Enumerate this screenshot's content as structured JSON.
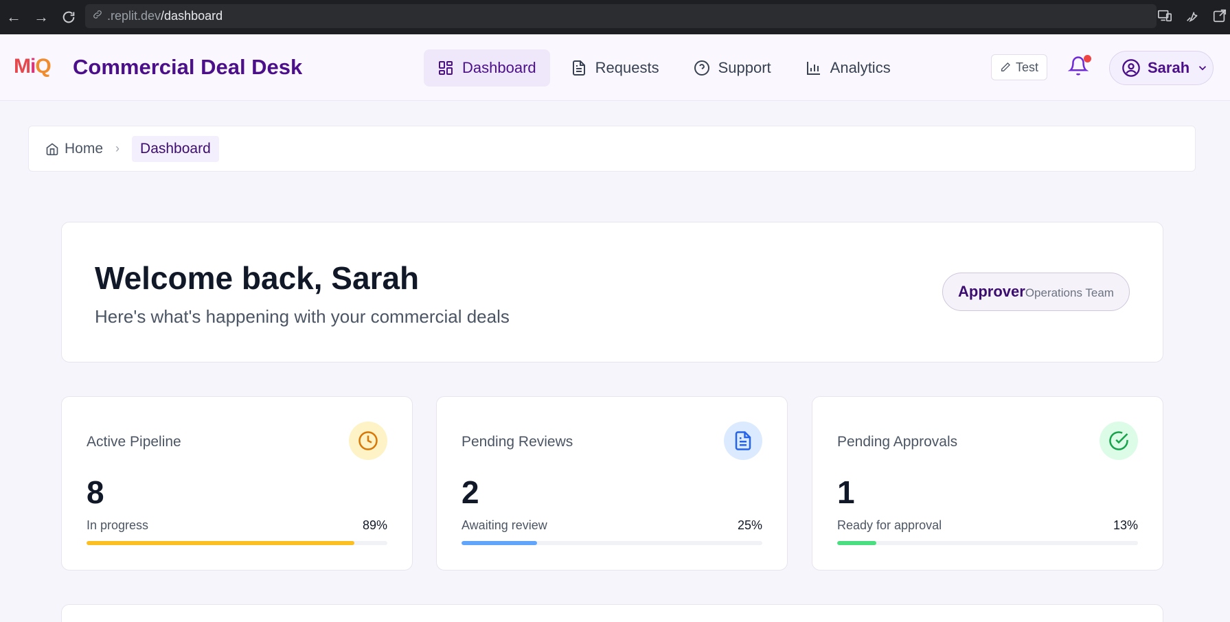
{
  "browser": {
    "url_host": ".replit.dev",
    "url_path": "/dashboard"
  },
  "header": {
    "logo": {
      "m": "M",
      "i": "i",
      "q": "Q"
    },
    "title": "Commercial Deal Desk",
    "nav": [
      {
        "label": "Dashboard",
        "icon": "dashboard-grid-icon",
        "active": true
      },
      {
        "label": "Requests",
        "icon": "document-icon",
        "active": false
      },
      {
        "label": "Support",
        "icon": "help-circle-icon",
        "active": false
      },
      {
        "label": "Analytics",
        "icon": "bar-chart-icon",
        "active": false
      }
    ],
    "test_label": "Test",
    "user_name": "Sarah",
    "has_notification": true
  },
  "breadcrumb": {
    "home": "Home",
    "current": "Dashboard"
  },
  "welcome": {
    "heading": "Welcome back, Sarah",
    "subheading": "Here's what's happening with your commercial deals",
    "role": "Approver",
    "team": "Operations Team"
  },
  "stats": [
    {
      "label": "Active Pipeline",
      "value": "8",
      "sub": "In progress",
      "percent": "89%",
      "progress": 0.89,
      "color": "#fbbf24",
      "icon_bg": "#fef3c7",
      "icon_color": "#d97706",
      "icon": "clock-icon"
    },
    {
      "label": "Pending Reviews",
      "value": "2",
      "sub": "Awaiting review",
      "percent": "25%",
      "progress": 0.25,
      "color": "#60a5fa",
      "icon_bg": "#dbeafe",
      "icon_color": "#2563eb",
      "icon": "document-icon"
    },
    {
      "label": "Pending Approvals",
      "value": "1",
      "sub": "Ready for approval",
      "percent": "13%",
      "progress": 0.13,
      "color": "#4ade80",
      "icon_bg": "#dcfce7",
      "icon_color": "#16a34a",
      "icon": "check-circle-icon"
    }
  ]
}
